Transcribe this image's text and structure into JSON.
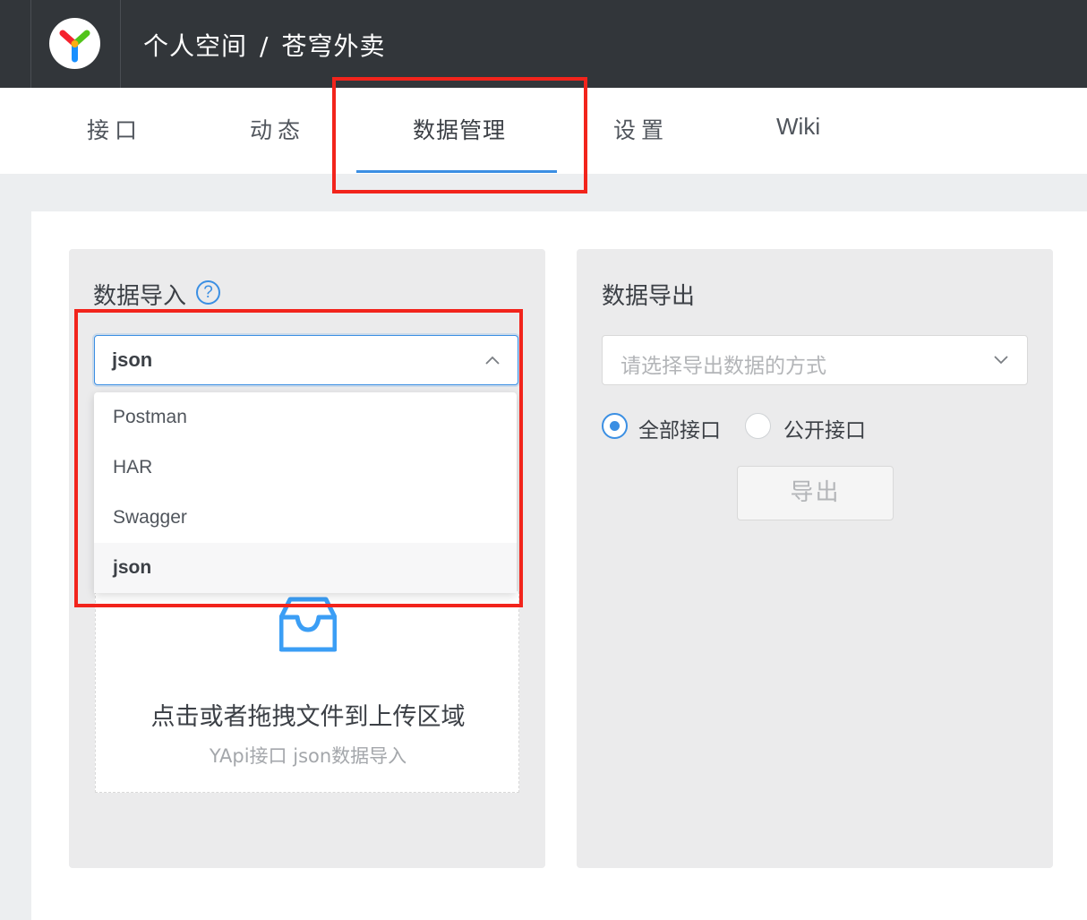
{
  "header": {
    "breadcrumb_space": "个人空间",
    "breadcrumb_sep": "/",
    "breadcrumb_project": "苍穹外卖"
  },
  "tabs": [
    {
      "label": "接口"
    },
    {
      "label": "动态"
    },
    {
      "label": "数据管理",
      "active": true
    },
    {
      "label": "设置"
    },
    {
      "label": "Wiki"
    }
  ],
  "import_panel": {
    "title": "数据导入",
    "help_icon": "?",
    "selected_value": "json",
    "options": [
      "Postman",
      "HAR",
      "Swagger",
      "json"
    ],
    "upload_text": "点击或者拖拽文件到上传区域",
    "upload_hint": "YApi接口 json数据导入"
  },
  "export_panel": {
    "title": "数据导出",
    "select_placeholder": "请选择导出数据的方式",
    "radio_all": "全部接口",
    "radio_public": "公开接口",
    "export_button": "导出"
  },
  "colors": {
    "accent": "#3b8fe3",
    "highlight_box": "#f2241c",
    "topbar": "#32363a"
  }
}
